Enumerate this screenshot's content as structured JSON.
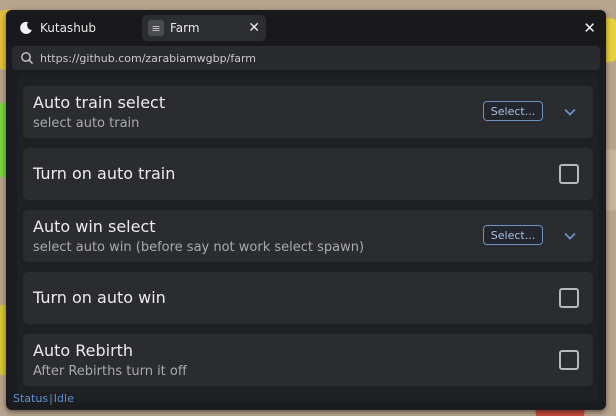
{
  "tabs": [
    {
      "label": "Kutashub",
      "icon": "moon-icon"
    },
    {
      "label": "Farm",
      "icon": "document-icon"
    }
  ],
  "url": {
    "value": "https://github.com/zarabiamwgbp/farm",
    "icon": "search-icon"
  },
  "items": [
    {
      "title": "Auto train select",
      "desc": "select auto train",
      "control": "dropdown",
      "button_label": "Select..."
    },
    {
      "title": "Turn on auto train",
      "control": "checkbox",
      "checked": false
    },
    {
      "title": "Auto win select",
      "desc": "select auto win (before say not work select spawn)",
      "control": "dropdown",
      "button_label": "Select..."
    },
    {
      "title": "Turn on auto win",
      "control": "checkbox",
      "checked": false
    },
    {
      "title": "Auto Rebirth",
      "desc": "After Rebirths turn it off",
      "control": "checkbox",
      "checked": false
    }
  ],
  "status": {
    "label": "Status",
    "separator": "|",
    "value": "Idle"
  },
  "colors": {
    "accent": "#6c93c4",
    "status": "#5e8fd6",
    "window": "#1b1c1f",
    "card": "#2b2c30"
  }
}
